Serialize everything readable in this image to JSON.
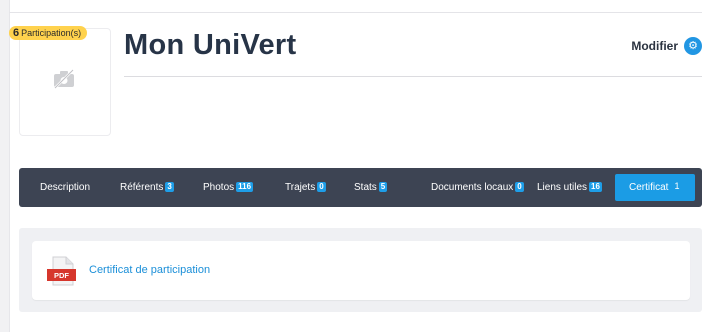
{
  "profile": {
    "title": "Mon UniVert",
    "participations_count": "6",
    "participations_label": "Participation(s)",
    "avatar_icon": "no-camera-icon"
  },
  "header": {
    "modify_label": "Modifier",
    "modify_icon": "gear-icon"
  },
  "tabs": [
    {
      "label": "Description",
      "count": ""
    },
    {
      "label": "Référents",
      "count": "3"
    },
    {
      "label": "Photos",
      "count": "116"
    },
    {
      "label": "Trajets",
      "count": "0"
    },
    {
      "label": "Stats",
      "count": "5"
    },
    {
      "label": "Documents locaux",
      "count": "0"
    },
    {
      "label": "Liens utiles",
      "count": "16"
    },
    {
      "label": "Certificat",
      "count": "1"
    }
  ],
  "active_tab": "Certificat",
  "content": {
    "file_type_label": "PDF",
    "certificate_link": "Certificat de participation"
  },
  "colors": {
    "accent": "#1b9ce5",
    "tabbar": "#3d4453",
    "badge": "#ffd24d",
    "title": "#273447",
    "pdf_red": "#d6362c"
  }
}
